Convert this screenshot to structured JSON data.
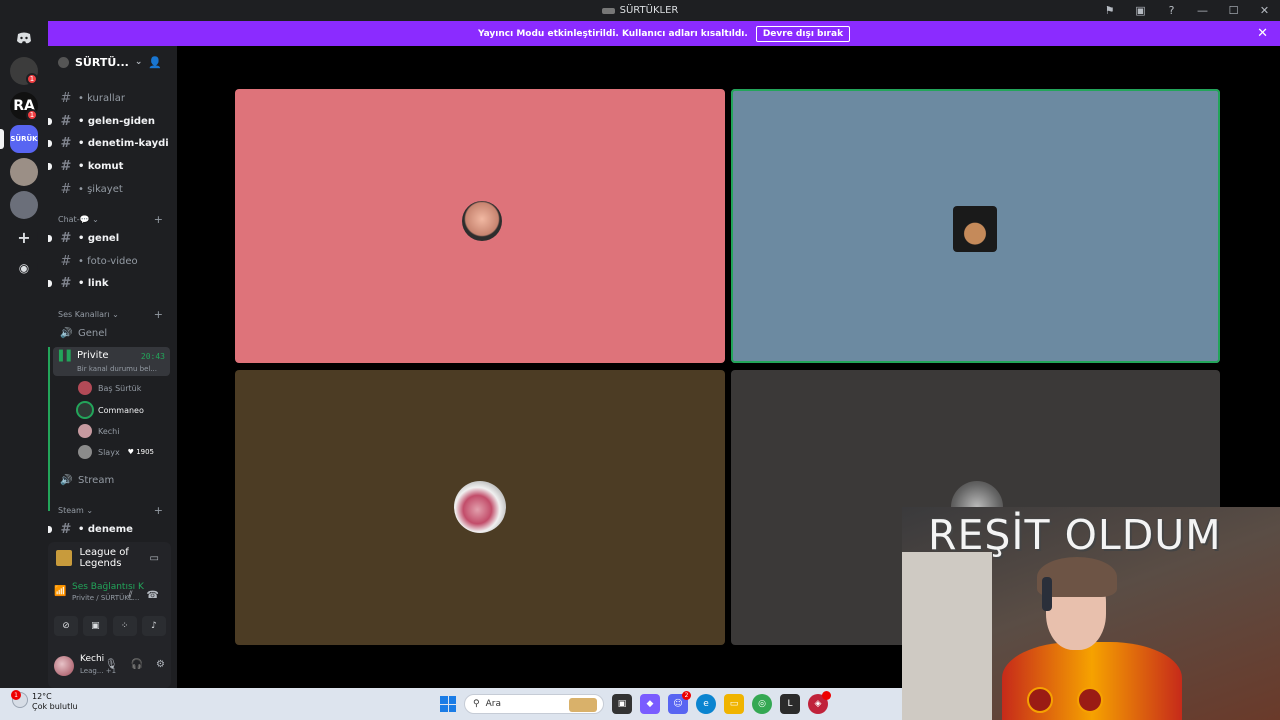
{
  "window": {
    "title": "SÜRTÜKLER"
  },
  "banner": {
    "message": "Yayıncı Modu etkinleştirildi. Kullanıcı adları kısaltıldı.",
    "button": "Devre dışı bırak"
  },
  "rail": {
    "servers": [
      {
        "label": "",
        "badge": "1",
        "color": "#3c3c3c"
      },
      {
        "label": "RA",
        "badge": "1",
        "color": "#111111"
      },
      {
        "label": "SÜRÜK",
        "badge": "",
        "color": "#5865f2"
      },
      {
        "label": "",
        "badge": "",
        "color": "#9b8f86"
      },
      {
        "label": "",
        "badge": "",
        "color": "#6b6f7a"
      }
    ]
  },
  "sidebar": {
    "server_name": "SÜRTÜ...",
    "channels_top": [
      {
        "name": "kurallar",
        "unread": false
      },
      {
        "name": "gelen-giden",
        "unread": true
      },
      {
        "name": "denetim-kaydi",
        "unread": true
      },
      {
        "name": "komut",
        "unread": true
      },
      {
        "name": "şikayet",
        "unread": false
      }
    ],
    "category_chat": "Chat-💬",
    "channels_chat": [
      {
        "name": "genel",
        "unread": true
      },
      {
        "name": "foto-video",
        "unread": false
      },
      {
        "name": "link",
        "unread": true
      }
    ],
    "category_voice": "Ses Kanalları",
    "voice_genel": "Genel",
    "voice_active": {
      "name": "Privite",
      "time": "20:43",
      "status": "Bir kanal durumu bel..."
    },
    "voice_users": [
      {
        "name": "Baş Sürtük",
        "tag": ""
      },
      {
        "name": "Commaneo",
        "tag": ""
      },
      {
        "name": "Kechi",
        "tag": ""
      },
      {
        "name": "Slayx",
        "tag": "1905"
      }
    ],
    "voice_stream": "Stream",
    "category_steam": "Steam",
    "channel_deneme": "deneme"
  },
  "panel": {
    "game": "League of Legends",
    "voice_title": "Ses Bağlantısı K",
    "voice_sub": "Privite / SÜRTÜKL...",
    "user_name": "Kechi",
    "user_status": "Leag...",
    "user_extra": "+1"
  },
  "webcam": {
    "overlay": "REŞİT OLDUM"
  },
  "taskbar": {
    "temp": "12°C",
    "weather": "Çok bulutlu",
    "weather_badge": "1",
    "search_placeholder": "Ara",
    "discord_badge": "2"
  },
  "colors": {
    "accent_banner": "#8b2bff",
    "speaking": "#23a55a",
    "tile1": "#de737a",
    "tile2": "#6c8aa1",
    "tile3": "#4c3c24",
    "tile4": "#3b3938"
  }
}
